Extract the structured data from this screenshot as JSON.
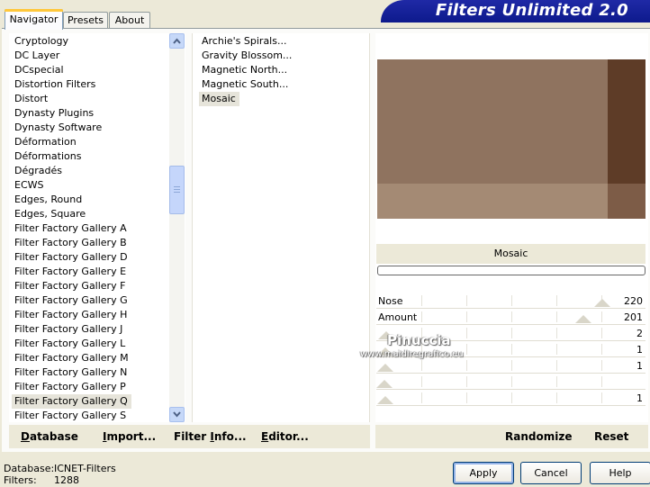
{
  "tabs": [
    {
      "label": "Navigator",
      "active": true
    },
    {
      "label": "Presets",
      "active": false
    },
    {
      "label": "About",
      "active": false
    }
  ],
  "banner_title": "Filters Unlimited 2.0",
  "categories": [
    "Cryptology",
    "DC Layer",
    "DCspecial",
    "Distortion Filters",
    "Distort",
    "Dynasty Plugins",
    "Dynasty Software",
    "Déformation",
    "Déformations",
    "Dégradés",
    "ECWS",
    "Edges, Round",
    "Edges, Square",
    "Filter Factory Gallery A",
    "Filter Factory Gallery B",
    "Filter Factory Gallery D",
    "Filter Factory Gallery E",
    "Filter Factory Gallery F",
    "Filter Factory Gallery G",
    "Filter Factory Gallery H",
    "Filter Factory Gallery J",
    "Filter Factory Gallery L",
    "Filter Factory Gallery M",
    "Filter Factory Gallery N",
    "Filter Factory Gallery P",
    "Filter Factory Gallery Q",
    "Filter Factory Gallery S"
  ],
  "selected_category": "Filter Factory Gallery Q",
  "filters": [
    "Archie's Spirals...",
    "Gravity Blossom...",
    "Magnetic North...",
    "Magnetic South...",
    "Mosaic"
  ],
  "selected_filter": "Mosaic",
  "filter_title": "Mosaic",
  "sliders": [
    {
      "label": "Nose",
      "value": "220",
      "level": 220
    },
    {
      "label": "Amount",
      "value": "201",
      "level": 201
    },
    {
      "label": "",
      "value": "2",
      "level": 2
    },
    {
      "label": "",
      "value": "1",
      "level": 1
    },
    {
      "label": "",
      "value": "1",
      "level": 1
    },
    {
      "label": "",
      "value": "",
      "level": 0
    },
    {
      "label": "",
      "value": "1",
      "level": 1
    }
  ],
  "toolbar": {
    "database": {
      "pre": "",
      "u": "D",
      "post": "atabase"
    },
    "import": {
      "pre": "",
      "u": "I",
      "post": "mport..."
    },
    "filter_info": {
      "pre": "Filter ",
      "u": "I",
      "post": "nfo..."
    },
    "editor": {
      "pre": "",
      "u": "E",
      "post": "ditor..."
    },
    "randomize": "Randomize",
    "reset": "Reset"
  },
  "status": {
    "database_label": "Database:",
    "database_value": "ICNET-Filters",
    "filters_label": "Filters:",
    "filters_value": "1288"
  },
  "buttons": {
    "apply": "Apply",
    "cancel": "Cancel",
    "help": "Help"
  },
  "watermark": {
    "name": "Pinuccia",
    "url": "www.maidiregrafico.eu"
  },
  "colors": {
    "preview_main": "#8b6e5a",
    "preview_right": "#5e3c27",
    "preview_bottom": "#a48a74",
    "preview_corner": "#7d5c47",
    "banner": "#1a249e"
  }
}
